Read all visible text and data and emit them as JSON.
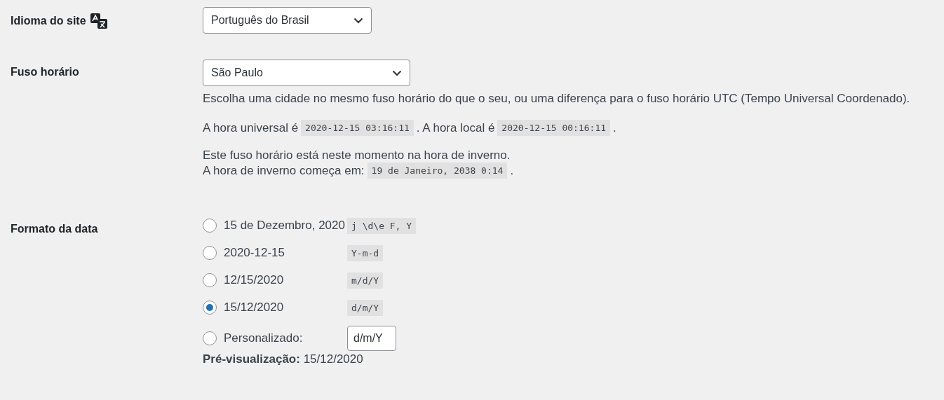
{
  "settings": [
    {
      "kind": "select",
      "label": "Idioma do site",
      "value": "Português do Brasil"
    },
    {
      "kind": "timezone",
      "label": "Fuso horário",
      "value": "São Paulo",
      "description": "Escolha uma cidade no mesmo fuso horário do que o seu, ou uma diferença para o fuso horário UTC (Tempo Universal Coordenado).",
      "time_line": [
        {
          "kind": "text",
          "text": "A hora universal é"
        },
        {
          "kind": "code",
          "text": "2020-12-15 03:16:11"
        },
        {
          "kind": "text",
          "text": ". A hora local é"
        },
        {
          "kind": "code",
          "text": "2020-12-15 00:16:11"
        },
        {
          "kind": "text",
          "text": "."
        }
      ],
      "dst_note": "Este fuso horário está neste momento na hora de inverno.",
      "dst_line": [
        {
          "kind": "text",
          "text": "A hora de inverno começa em:"
        },
        {
          "kind": "code",
          "text": "19 de Janeiro, 2038 0:14"
        },
        {
          "kind": "text",
          "text": "."
        }
      ]
    },
    {
      "kind": "radio",
      "label": "Formato da data",
      "options": [
        {
          "kind": "preset",
          "label": "15 de Dezembro, 2020",
          "format": "j \\d\\e F, Y",
          "selected": false
        },
        {
          "kind": "preset",
          "label": "2020-12-15",
          "format": "Y-m-d",
          "selected": false
        },
        {
          "kind": "preset",
          "label": "12/15/2020",
          "format": "m/d/Y",
          "selected": false
        },
        {
          "kind": "preset",
          "label": "15/12/2020",
          "format": "d/m/Y",
          "selected": true
        },
        {
          "kind": "custom",
          "label": "Personalizado:",
          "value": "d/m/Y",
          "selected": false
        }
      ],
      "preview": "**Pré-visualização:** 15/12/2020"
    }
  ]
}
